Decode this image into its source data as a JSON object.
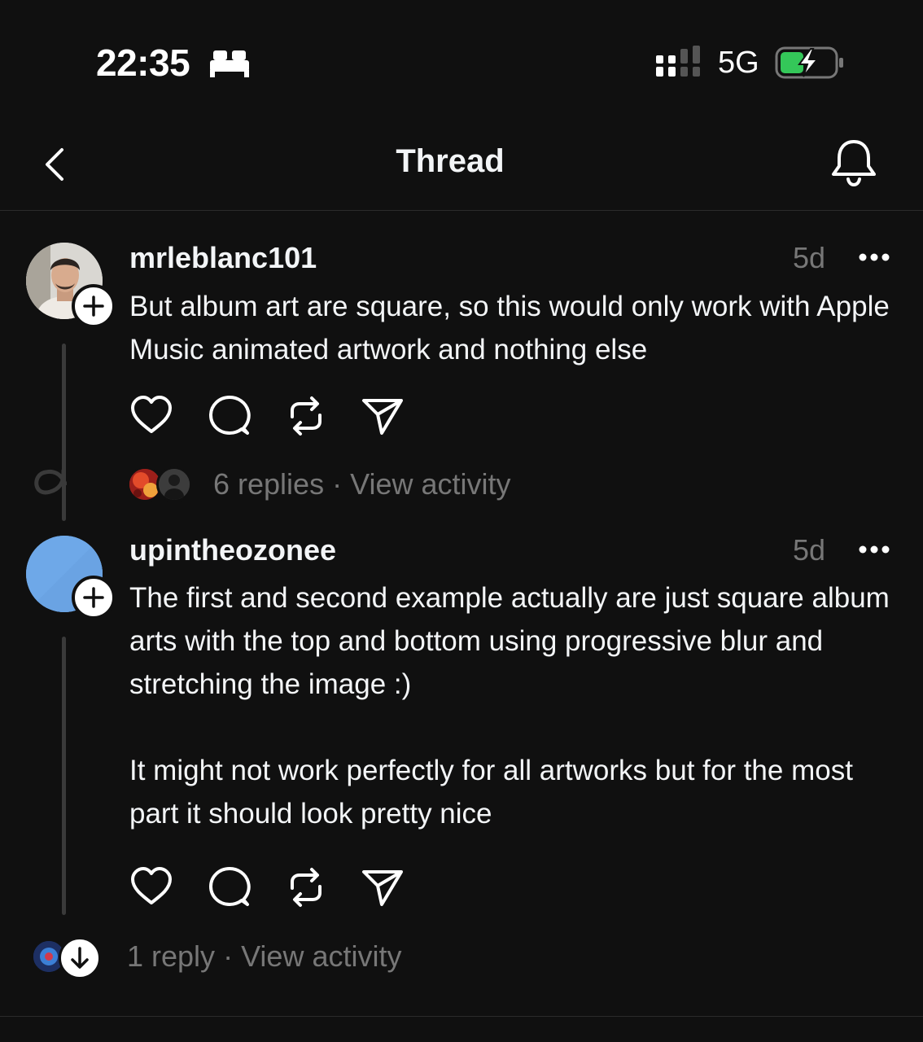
{
  "status": {
    "time": "22:35",
    "network": "5G"
  },
  "nav": {
    "title": "Thread"
  },
  "posts": [
    {
      "username": "mrleblanc101",
      "time_ago": "5d",
      "text": "But album art are square, so this would only work with Apple Music animated artwork and nothing else",
      "replies_label": "6 replies",
      "separator": "·",
      "activity_label": "View activity"
    },
    {
      "username": "upintheozonee",
      "time_ago": "5d",
      "text": "The first and second example actually are just square album arts with the top and bottom using progressive blur and stretching the image :)\n\nIt might not work perfectly for all artworks but for the most part it should look pretty nice",
      "replies_label": "1 reply",
      "separator": "·",
      "activity_label": "View activity"
    }
  ],
  "icons": [
    "bed-icon",
    "signal-icon",
    "battery-charging-icon",
    "back-chevron-icon",
    "bell-icon",
    "plus-icon",
    "more-icon",
    "heart-icon",
    "comment-icon",
    "repost-icon",
    "share-icon",
    "arrow-down-icon"
  ],
  "colors": {
    "background": "#101010",
    "text": "#f3f5f7",
    "secondary": "#777777",
    "battery_green": "#34c759",
    "avatar_blue": "#6ea8e8"
  }
}
